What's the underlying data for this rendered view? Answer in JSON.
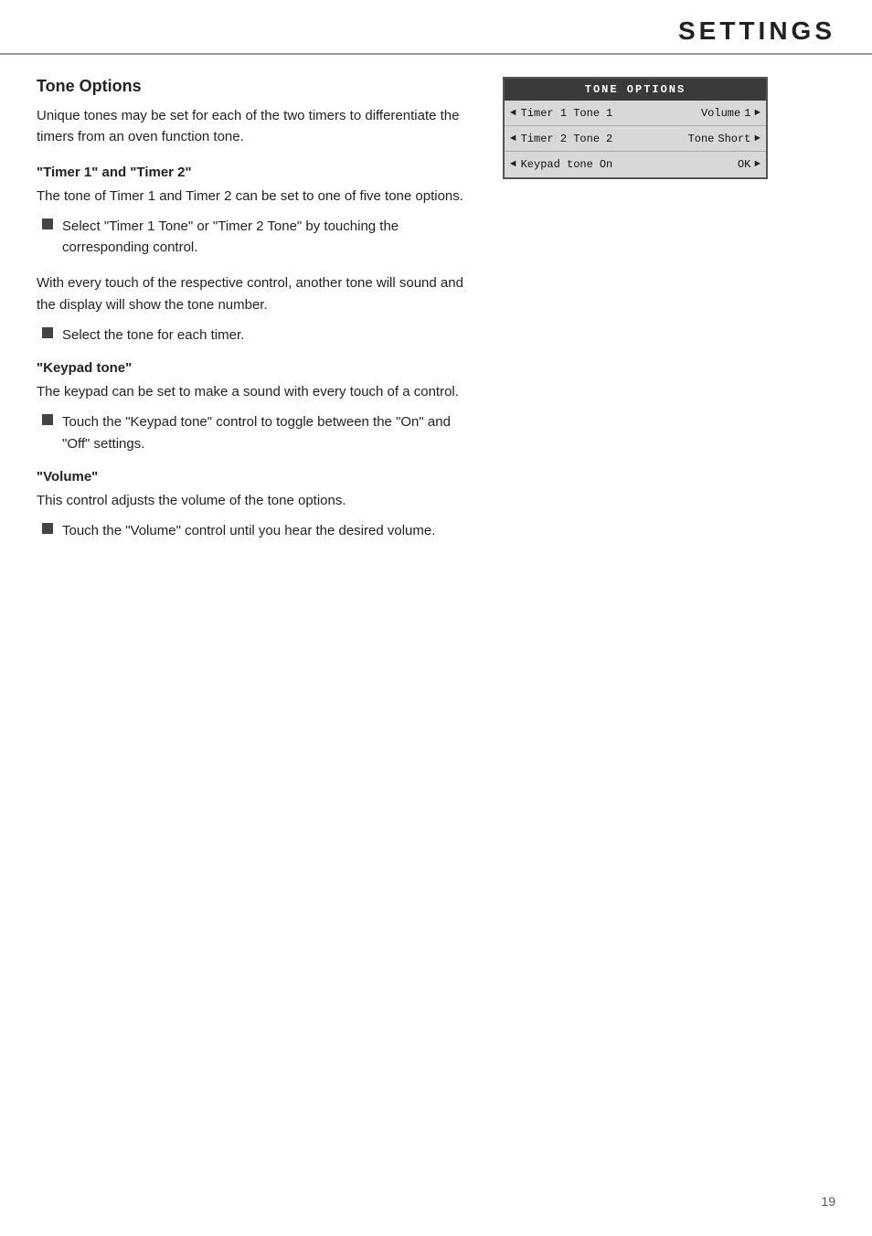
{
  "header": {
    "title": "SETTINGS"
  },
  "page": {
    "number": "19"
  },
  "section": {
    "title": "Tone Options",
    "intro": "Unique tones may be set for each of the two timers to differentiate the timers from an oven function tone.",
    "subsections": [
      {
        "id": "timer-tones",
        "heading": "\"Timer 1\" and \"Timer 2\"",
        "text": "The tone of Timer 1 and Timer 2 can be set to one of five tone options.",
        "bullets": [
          {
            "text": "Select \"Timer 1 Tone\" or \"Timer 2 Tone\" by touching the corresponding control."
          }
        ]
      },
      {
        "id": "tone-cycling",
        "heading": null,
        "text": "With every touch of the respective control, another tone will sound and the display will show the tone number.",
        "bullets": [
          {
            "text": "Select the tone for each timer."
          }
        ]
      },
      {
        "id": "keypad-tone",
        "heading": "\"Keypad tone\"",
        "text": "The keypad can be set to make a sound with every touch of a control.",
        "bullets": [
          {
            "text": "Touch the \"Keypad tone\" control to toggle between the \"On\" and \"Off\" settings."
          }
        ]
      },
      {
        "id": "volume",
        "heading": "\"Volume\"",
        "text": "This control adjusts the volume of the tone options.",
        "bullets": [
          {
            "text": "Touch the \"Volume\" control until you hear the desired volume."
          }
        ]
      }
    ]
  },
  "ui_panel": {
    "header": "TONE OPTIONS",
    "rows": [
      {
        "left_arrow": "◄",
        "label": "Timer 1 Tone",
        "value": "1",
        "right_label": "Volume",
        "right_value": "1",
        "right_arrow": "►"
      },
      {
        "left_arrow": "◄",
        "label": "Timer 2 Tone",
        "value": "2",
        "right_label": "Tone",
        "right_value": "Short",
        "right_arrow": "►"
      },
      {
        "left_arrow": "◄",
        "label": "Keypad tone",
        "value": "On",
        "right_label": "",
        "right_value": "OK",
        "right_arrow": "►"
      }
    ]
  }
}
